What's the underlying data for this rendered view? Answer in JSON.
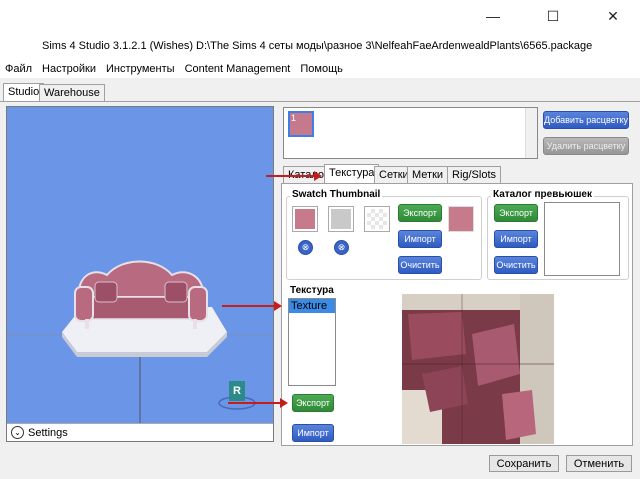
{
  "window": {
    "title": "Sims 4 Studio 3.1.2.1 (Wishes)  D:\\The Sims 4 сеты моды\\разное 3\\NelfeahFaeArdenwealdPlants\\6565.package",
    "minimize": "—",
    "maximize": "☐",
    "close": "✕"
  },
  "menu": [
    "Файл",
    "Настройки",
    "Инструменты",
    "Content Management",
    "Помощь"
  ],
  "top_tabs": {
    "studio": "Studio",
    "warehouse": "Warehouse"
  },
  "viewport": {
    "settings_label": "Settings",
    "settings_icon": "chevron-down-circle-icon",
    "badge_letter": "R"
  },
  "swatches": {
    "item_label": "1"
  },
  "swatch_buttons": {
    "add": "Добавить расцветку",
    "delete": "Удалить расцветку"
  },
  "tabs": [
    "Каталог",
    "Текстура",
    "Сетки",
    "Метки",
    "Rig/Slots"
  ],
  "swatch_thumbnail": {
    "title": "Swatch Thumbnail",
    "export": "Экспорт",
    "import": "Импорт",
    "clear": "Очистить",
    "remove_icon": "⊗"
  },
  "catalog_preview": {
    "title": "Каталог превьюшек",
    "export": "Экспорт",
    "import": "Импорт",
    "clear": "Очистить"
  },
  "texture": {
    "title": "Текстура",
    "items": [
      "Texture"
    ],
    "export": "Экспорт",
    "import": "Импорт"
  },
  "footer": {
    "save": "Сохранить",
    "cancel": "Отменить"
  },
  "colors": {
    "viewport_bg": "#6b95e6",
    "sofa_rose": "#b76a80",
    "arrow_red": "#c51d1d",
    "accent_blue": "#3b8ae6"
  }
}
